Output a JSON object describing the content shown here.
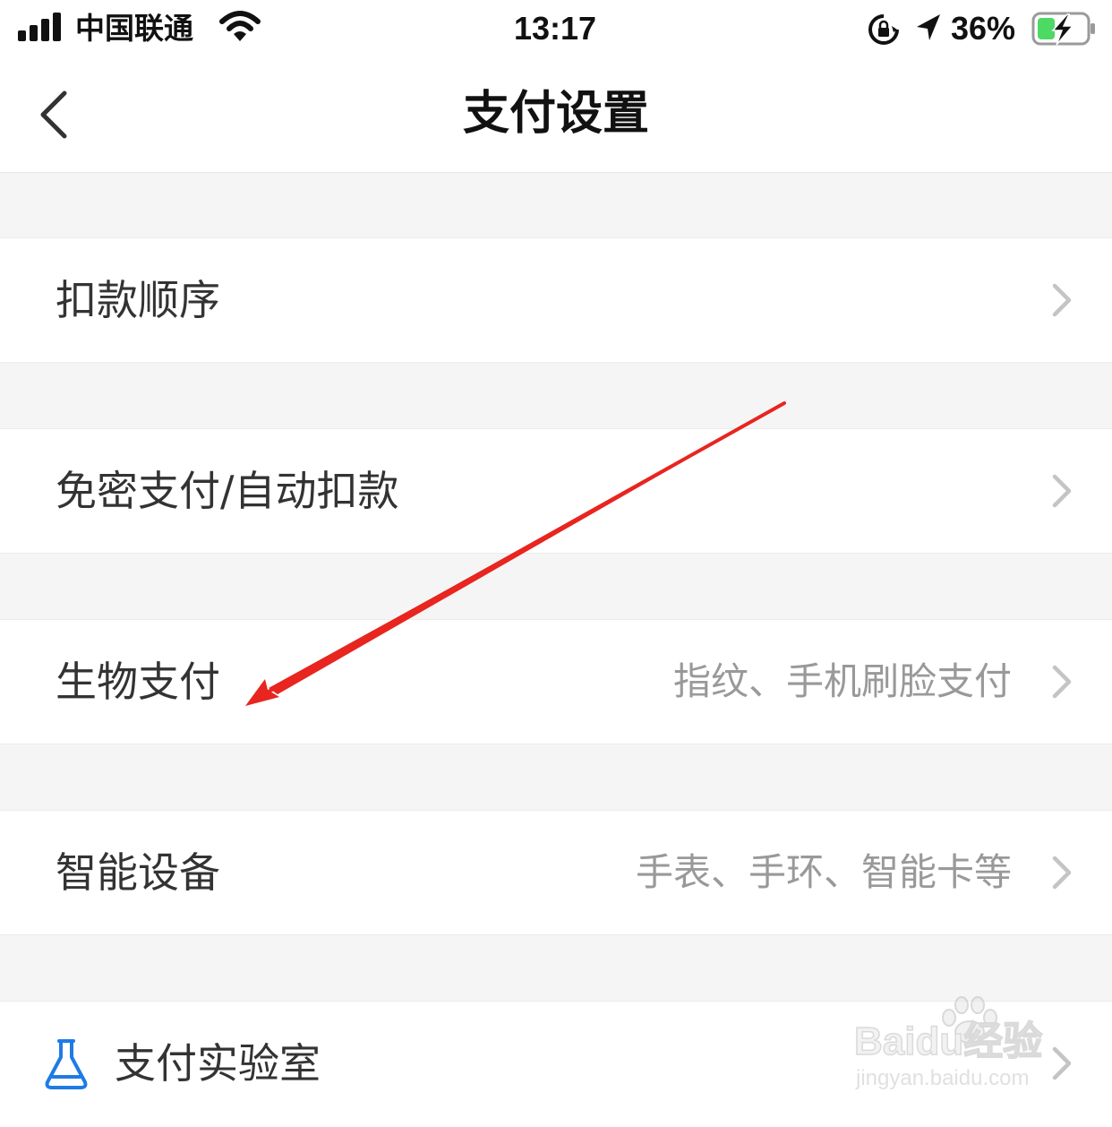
{
  "status_bar": {
    "carrier": "中国联通",
    "time": "13:17",
    "battery_percent": "36%",
    "battery_level": 0.36,
    "charging": true
  },
  "nav": {
    "title": "支付设置",
    "back_icon": "chevron-left-icon"
  },
  "rows": [
    {
      "label": "扣款顺序",
      "value": ""
    },
    {
      "label": "免密支付/自动扣款",
      "value": ""
    },
    {
      "label": "生物支付",
      "value": "指纹、手机刷脸支付"
    },
    {
      "label": "智能设备",
      "value": "手表、手环、智能卡等"
    },
    {
      "label": "支付实验室",
      "value": "",
      "icon": "flask-icon"
    }
  ],
  "colors": {
    "background": "#f5f5f5",
    "row_background": "#ffffff",
    "label_text": "#333333",
    "value_text": "#999999",
    "chevron": "#c4c4c4",
    "icon_blue": "#1e7be6",
    "annotation_arrow": "#e8251f"
  },
  "watermark": {
    "logo_text": "Baidu经验",
    "url": "jingyan.baidu.com"
  }
}
